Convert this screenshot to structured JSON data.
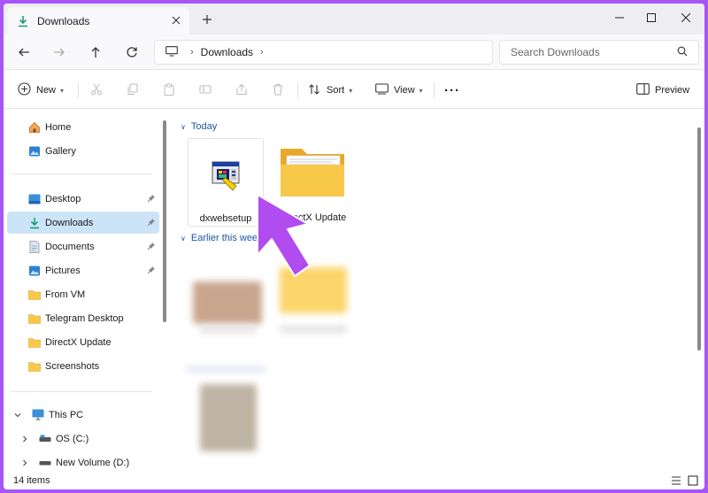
{
  "window": {
    "tab_title": "Downloads"
  },
  "address": {
    "segments": [
      "Downloads"
    ],
    "search_placeholder": "Search Downloads"
  },
  "commands": {
    "new": "New",
    "sort": "Sort",
    "view": "View",
    "more": "···",
    "preview": "Preview"
  },
  "sidebar": {
    "quick": [
      {
        "label": "Home",
        "icon": "home-icon"
      },
      {
        "label": "Gallery",
        "icon": "gallery-icon"
      }
    ],
    "pinned": [
      {
        "label": "Desktop",
        "icon": "desktop-folder-icon",
        "pinned": true
      },
      {
        "label": "Downloads",
        "icon": "download-icon",
        "pinned": true,
        "selected": true
      },
      {
        "label": "Documents",
        "icon": "documents-icon",
        "pinned": true
      },
      {
        "label": "Pictures",
        "icon": "pictures-icon",
        "pinned": true
      },
      {
        "label": "From VM",
        "icon": "folder-icon"
      },
      {
        "label": "Telegram Desktop",
        "icon": "folder-icon"
      },
      {
        "label": "DirectX Update",
        "icon": "folder-icon"
      },
      {
        "label": "Screenshots",
        "icon": "folder-icon"
      }
    ],
    "this_pc": "This PC",
    "drives": [
      {
        "label": "OS (C:)"
      },
      {
        "label": "New Volume (D:)"
      }
    ]
  },
  "content": {
    "group_today": "Today",
    "group_earlier": "Earlier this week",
    "files_today": [
      {
        "name": "dxwebsetup",
        "type": "setup-exe-icon"
      },
      {
        "name": "DirectX Update",
        "type": "folder-icon"
      }
    ]
  },
  "status": {
    "item_count": "14 items"
  },
  "colors": {
    "frame": "#a855f7",
    "accent": "#0067c0",
    "arrow": "#b14cf0",
    "folder": "#f8c84b",
    "selected": "#cce4f7"
  }
}
